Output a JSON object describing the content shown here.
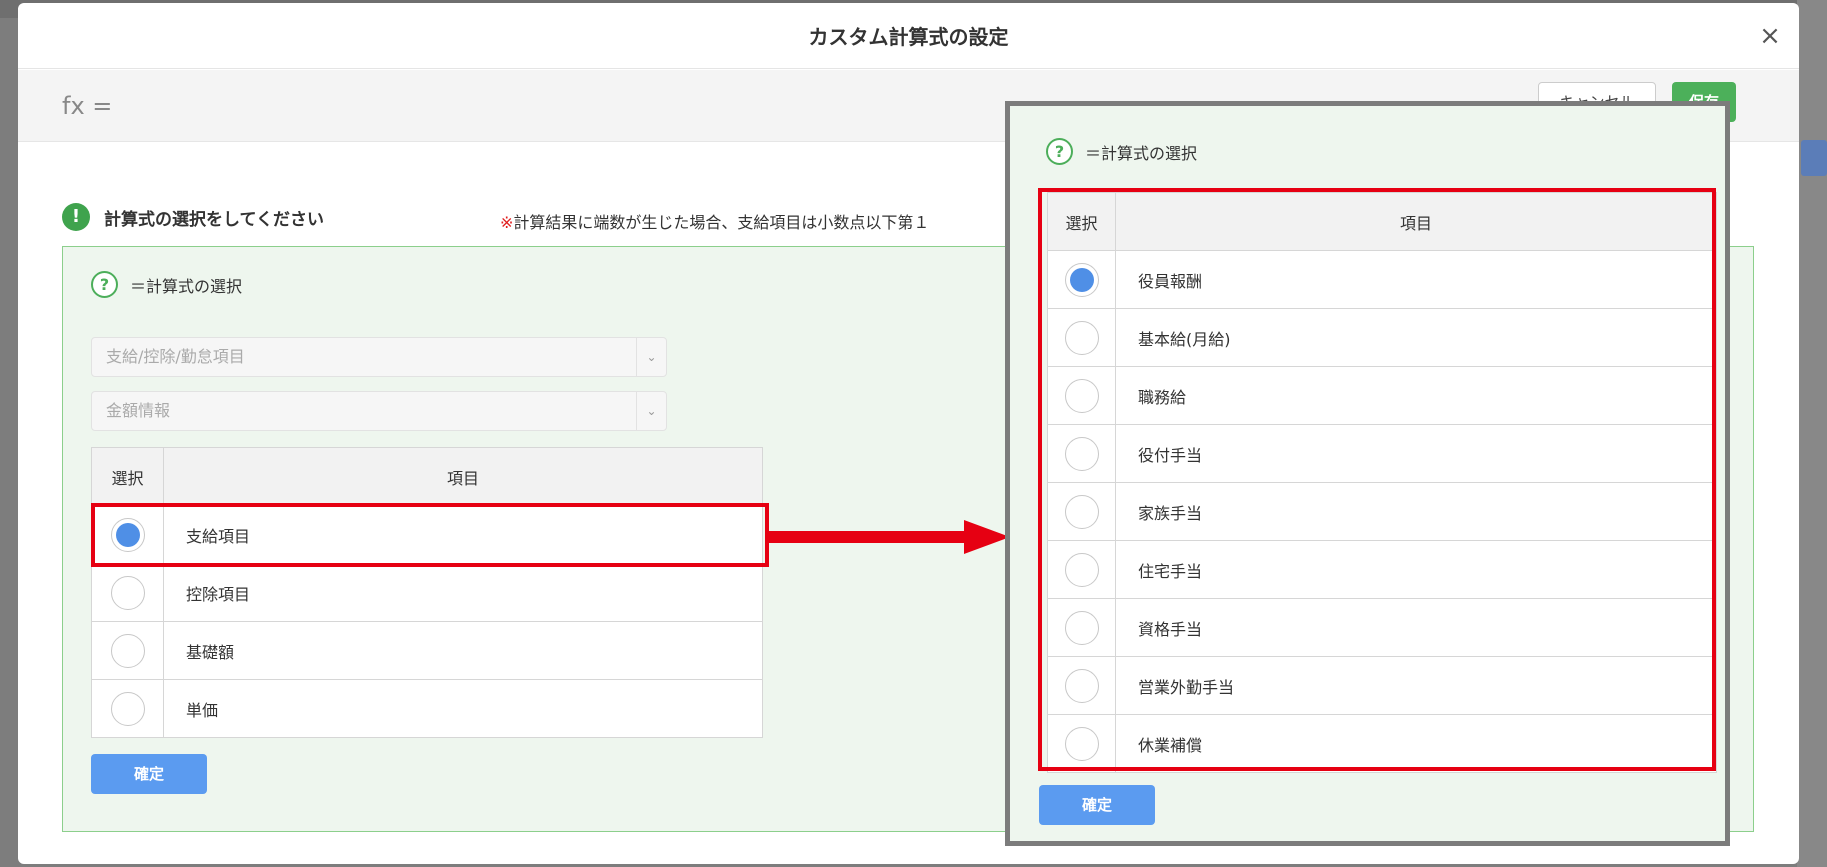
{
  "modal": {
    "title": "カスタム計算式の設定",
    "close_glyph": "×"
  },
  "formula_bar": {
    "fx_label": "fx =",
    "cancel_label": "キャンセル",
    "save_label": "保存"
  },
  "instruction": {
    "icon_glyph": "!",
    "text": "計算式の選択をしてください",
    "note_mark": "※",
    "note_text": "計算結果に端数が生じた場合、支給項目は小数点以下第１"
  },
  "left_panel": {
    "help_glyph": "?",
    "help_text": "＝計算式の選択",
    "select1_value": "支給/控除/勤怠項目",
    "select2_value": "金額情報",
    "table": {
      "col_select": "選択",
      "col_item": "項目",
      "rows": [
        {
          "label": "支給項目",
          "selected": true
        },
        {
          "label": "控除項目",
          "selected": false
        },
        {
          "label": "基礎額",
          "selected": false
        },
        {
          "label": "単価",
          "selected": false
        }
      ]
    },
    "confirm_label": "確定"
  },
  "popup": {
    "help_glyph": "?",
    "help_text": "＝計算式の選択",
    "table": {
      "col_select": "選択",
      "col_item": "項目",
      "rows": [
        {
          "label": "役員報酬",
          "selected": true
        },
        {
          "label": "基本給(月給)",
          "selected": false
        },
        {
          "label": "職務給",
          "selected": false
        },
        {
          "label": "役付手当",
          "selected": false
        },
        {
          "label": "家族手当",
          "selected": false
        },
        {
          "label": "住宅手当",
          "selected": false
        },
        {
          "label": "資格手当",
          "selected": false
        },
        {
          "label": "営業外勤手当",
          "selected": false
        },
        {
          "label": "休業補償",
          "selected": false
        }
      ]
    },
    "confirm_label": "確定"
  },
  "colors": {
    "highlight": "#e60012",
    "radio_selected": "#4f8fe6",
    "accent_green": "#4cae5a",
    "confirm_blue": "#5b9bf0"
  },
  "icons": [
    "close-icon",
    "alert-icon",
    "help-icon",
    "chevron-down-icon",
    "arrow-right-icon"
  ]
}
